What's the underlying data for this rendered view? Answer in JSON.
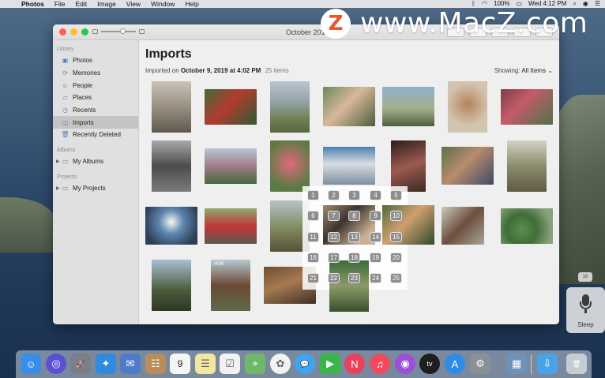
{
  "menubar": {
    "app": "Photos",
    "items": [
      "File",
      "Edit",
      "Image",
      "View",
      "Window",
      "Help"
    ],
    "battery": "100%",
    "clock": "Wed 4:12 PM"
  },
  "watermark": {
    "logo": "Z",
    "text": "www.MacZ.com"
  },
  "window": {
    "title": "October 2019"
  },
  "sidebar": {
    "library_header": "Library",
    "library": [
      {
        "label": "Photos",
        "icon": "photos-icon"
      },
      {
        "label": "Memories",
        "icon": "memories-icon"
      },
      {
        "label": "People",
        "icon": "people-icon"
      },
      {
        "label": "Places",
        "icon": "places-icon"
      },
      {
        "label": "Recents",
        "icon": "recents-icon"
      },
      {
        "label": "Imports",
        "icon": "imports-icon",
        "selected": true
      },
      {
        "label": "Recently Deleted",
        "icon": "trash-icon"
      }
    ],
    "albums_header": "Albums",
    "albums_item": "My Albums",
    "projects_header": "Projects",
    "projects_item": "My Projects"
  },
  "main": {
    "title": "Imports",
    "subtitle_prefix": "Imported on",
    "subtitle_date": "October 9, 2019 at 4:02 PM",
    "count": "25 items",
    "showing_label": "Showing:",
    "showing_value": "All Items",
    "hdr_badge": "HDR"
  },
  "grid_numbers": [
    "1",
    "2",
    "3",
    "4",
    "5",
    "6",
    "7",
    "8",
    "9",
    "10",
    "11",
    "12",
    "13",
    "14",
    "15",
    "16",
    "17",
    "18",
    "19",
    "20",
    "21",
    "22",
    "23",
    "24",
    "25"
  ],
  "sleep": {
    "badge": "16",
    "label": "Sleep"
  },
  "dock": [
    "finder-icon",
    "siri-icon",
    "launchpad-icon",
    "safari-icon",
    "mail-icon",
    "contacts-icon",
    "calendar-icon",
    "notes-icon",
    "reminders-icon",
    "maps-icon",
    "photos-app-icon",
    "messages-icon",
    "facetime-icon",
    "news-icon",
    "music-icon",
    "podcasts-icon",
    "tv-icon",
    "app-store-icon",
    "system-preferences-icon",
    "preview-icon",
    "downloads-folder-icon",
    "trash-dock-icon"
  ],
  "dock_calendar_day": "9"
}
